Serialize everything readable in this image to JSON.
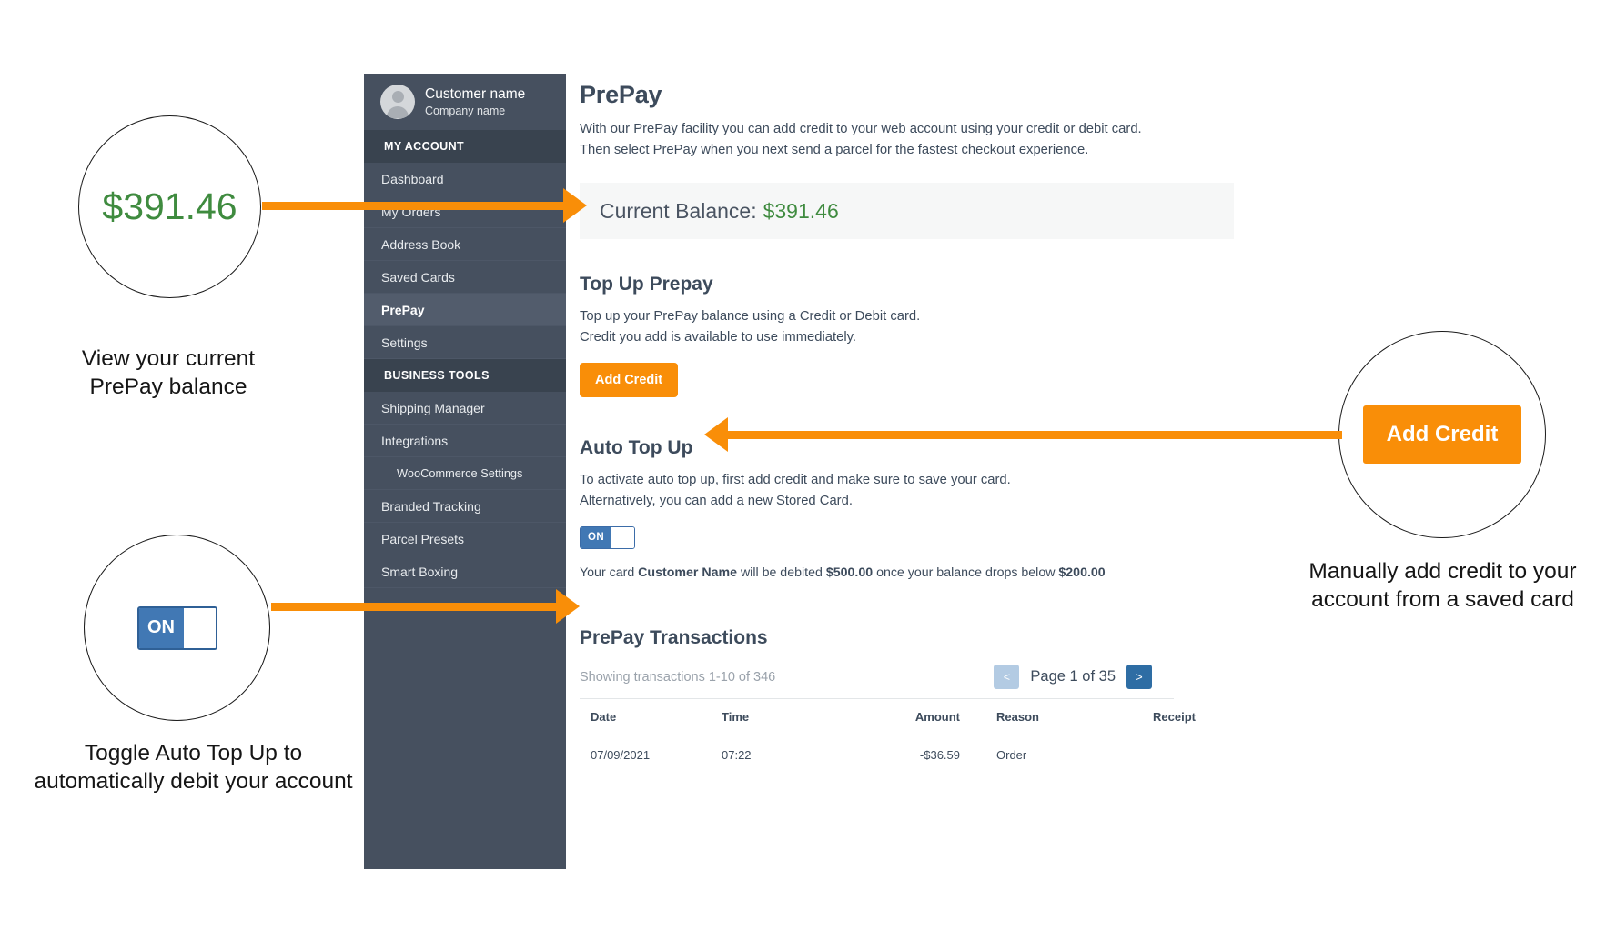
{
  "sidebar": {
    "profile": {
      "name": "Customer name",
      "company": "Company name",
      "avatar_icon": "user-avatar-icon"
    },
    "sections": [
      {
        "label": "MY ACCOUNT",
        "items": [
          {
            "label": "Dashboard",
            "active": false,
            "sub": false
          },
          {
            "label": "My Orders",
            "active": false,
            "sub": false
          },
          {
            "label": "Address Book",
            "active": false,
            "sub": false
          },
          {
            "label": "Saved Cards",
            "active": false,
            "sub": false
          },
          {
            "label": "PrePay",
            "active": true,
            "sub": false
          },
          {
            "label": "Settings",
            "active": false,
            "sub": false
          }
        ]
      },
      {
        "label": "BUSINESS TOOLS",
        "items": [
          {
            "label": "Shipping Manager",
            "active": false,
            "sub": false
          },
          {
            "label": "Integrations",
            "active": false,
            "sub": false
          },
          {
            "label": "WooCommerce Settings",
            "active": false,
            "sub": true
          },
          {
            "label": "Branded Tracking",
            "active": false,
            "sub": false
          },
          {
            "label": "Parcel Presets",
            "active": false,
            "sub": false
          },
          {
            "label": "Smart Boxing",
            "active": false,
            "sub": false
          }
        ]
      }
    ]
  },
  "main": {
    "page_title": "PrePay",
    "intro_line_1": "With our PrePay facility you can add credit to your web account using your credit or debit card.",
    "intro_line_2": "Then select PrePay when you next send a parcel for the fastest checkout experience.",
    "balance": {
      "label": "Current Balance:",
      "amount": "$391.46",
      "amount_color": "#3f8b3f"
    },
    "topup": {
      "title": "Top Up Prepay",
      "line_1": "Top up your PrePay balance using a Credit or Debit card.",
      "line_2": "Credit you add is available to use immediately.",
      "button_label": "Add Credit",
      "button_color": "#f98e08"
    },
    "autotopup": {
      "title": "Auto Top Up",
      "line_1": "To activate auto top up, first add credit and make sure to save your card.",
      "line_2": "Alternatively, you can add a new Stored Card.",
      "toggle_state": "ON",
      "toggle_color": "#4178b4",
      "debit_prefix": "Your card",
      "card_name": "Customer  Name",
      "debit_mid": "will be debited",
      "debit_amount": "$500.00",
      "debit_suffix": "once your balance drops below",
      "threshold_amount": "$200.00"
    },
    "transactions": {
      "title": "PrePay Transactions",
      "showing": "Showing transactions 1-10 of 346",
      "pager": {
        "prev_label": "<",
        "page_label": "Page 1 of 35",
        "next_label": ">"
      },
      "columns": [
        "Date",
        "Time",
        "Amount",
        "Reason",
        "Receipt"
      ],
      "rows": [
        {
          "date": "07/09/2021",
          "time": "07:22",
          "amount": "-$36.59",
          "reason": "Order",
          "receipt": ""
        }
      ]
    }
  },
  "annotations": {
    "balance": {
      "circle_value": "$391.46",
      "caption": "View your current PrePay balance"
    },
    "toggle": {
      "toggle_state": "ON",
      "caption": "Toggle Auto Top Up to automatically debit your account"
    },
    "add_credit": {
      "button_label": "Add Credit",
      "caption": "Manually add credit to your account from a saved card"
    },
    "arrow_color": "#f98e08"
  }
}
